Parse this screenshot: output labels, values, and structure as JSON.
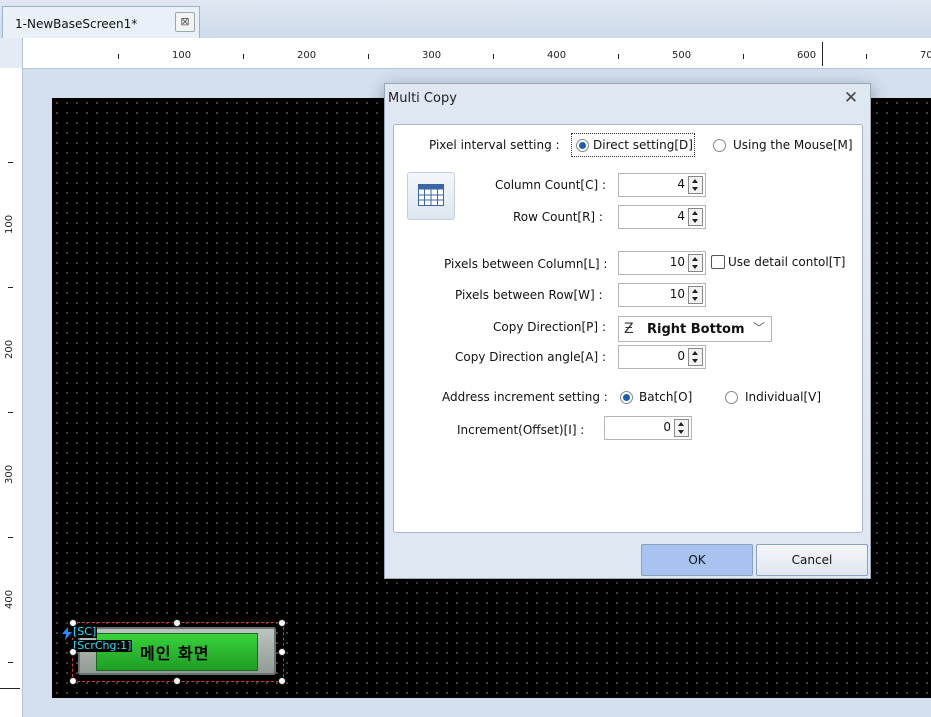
{
  "tab": {
    "title": "1-NewBaseScreen1*",
    "close_glyph": "⊠"
  },
  "ruler_h": {
    "labels": [
      "100",
      "200",
      "300",
      "400",
      "500",
      "600",
      "70"
    ]
  },
  "ruler_v": {
    "labels": [
      "100",
      "200",
      "300",
      "400"
    ]
  },
  "object": {
    "label_text": "메인 화면",
    "tag_sc": "[SC]",
    "tag_scrchg": "[ScrChg:1]"
  },
  "dialog": {
    "title": "Multi Copy",
    "close_glyph": "✕",
    "pixel_interval": {
      "label": "Pixel interval setting :",
      "options": [
        "Direct setting[D]",
        "Using the Mouse[M]"
      ],
      "selected": "Direct setting[D]"
    },
    "column_count": {
      "label": "Column Count[C] :",
      "value": "4"
    },
    "row_count": {
      "label": "Row Count[R] :",
      "value": "4"
    },
    "pixels_between_column": {
      "label": "Pixels between Column[L] :",
      "value": "10"
    },
    "use_detail_control": {
      "label": "Use detail contol[T]",
      "checked": false
    },
    "pixels_between_row": {
      "label": "Pixels between Row[W] :",
      "value": "10"
    },
    "copy_direction": {
      "label": "Copy Direction[P] :",
      "value": "Right Bottom",
      "icon": "direction-z-icon"
    },
    "copy_direction_angle": {
      "label": "Copy Direction angle[A] :",
      "value": "0"
    },
    "address_increment": {
      "label": "Address increment setting :",
      "options": [
        "Batch[O]",
        "Individual[V]"
      ],
      "selected": "Batch[O]"
    },
    "increment_offset": {
      "label": "Increment(Offset)[I] :",
      "value": "0"
    },
    "ok_label": "OK",
    "cancel_label": "Cancel"
  },
  "colors": {
    "screen_bg": "#000000",
    "ok_button": "#a9c3f1",
    "tag_text": "#1de4ff",
    "object_face": "#2fbf32"
  }
}
